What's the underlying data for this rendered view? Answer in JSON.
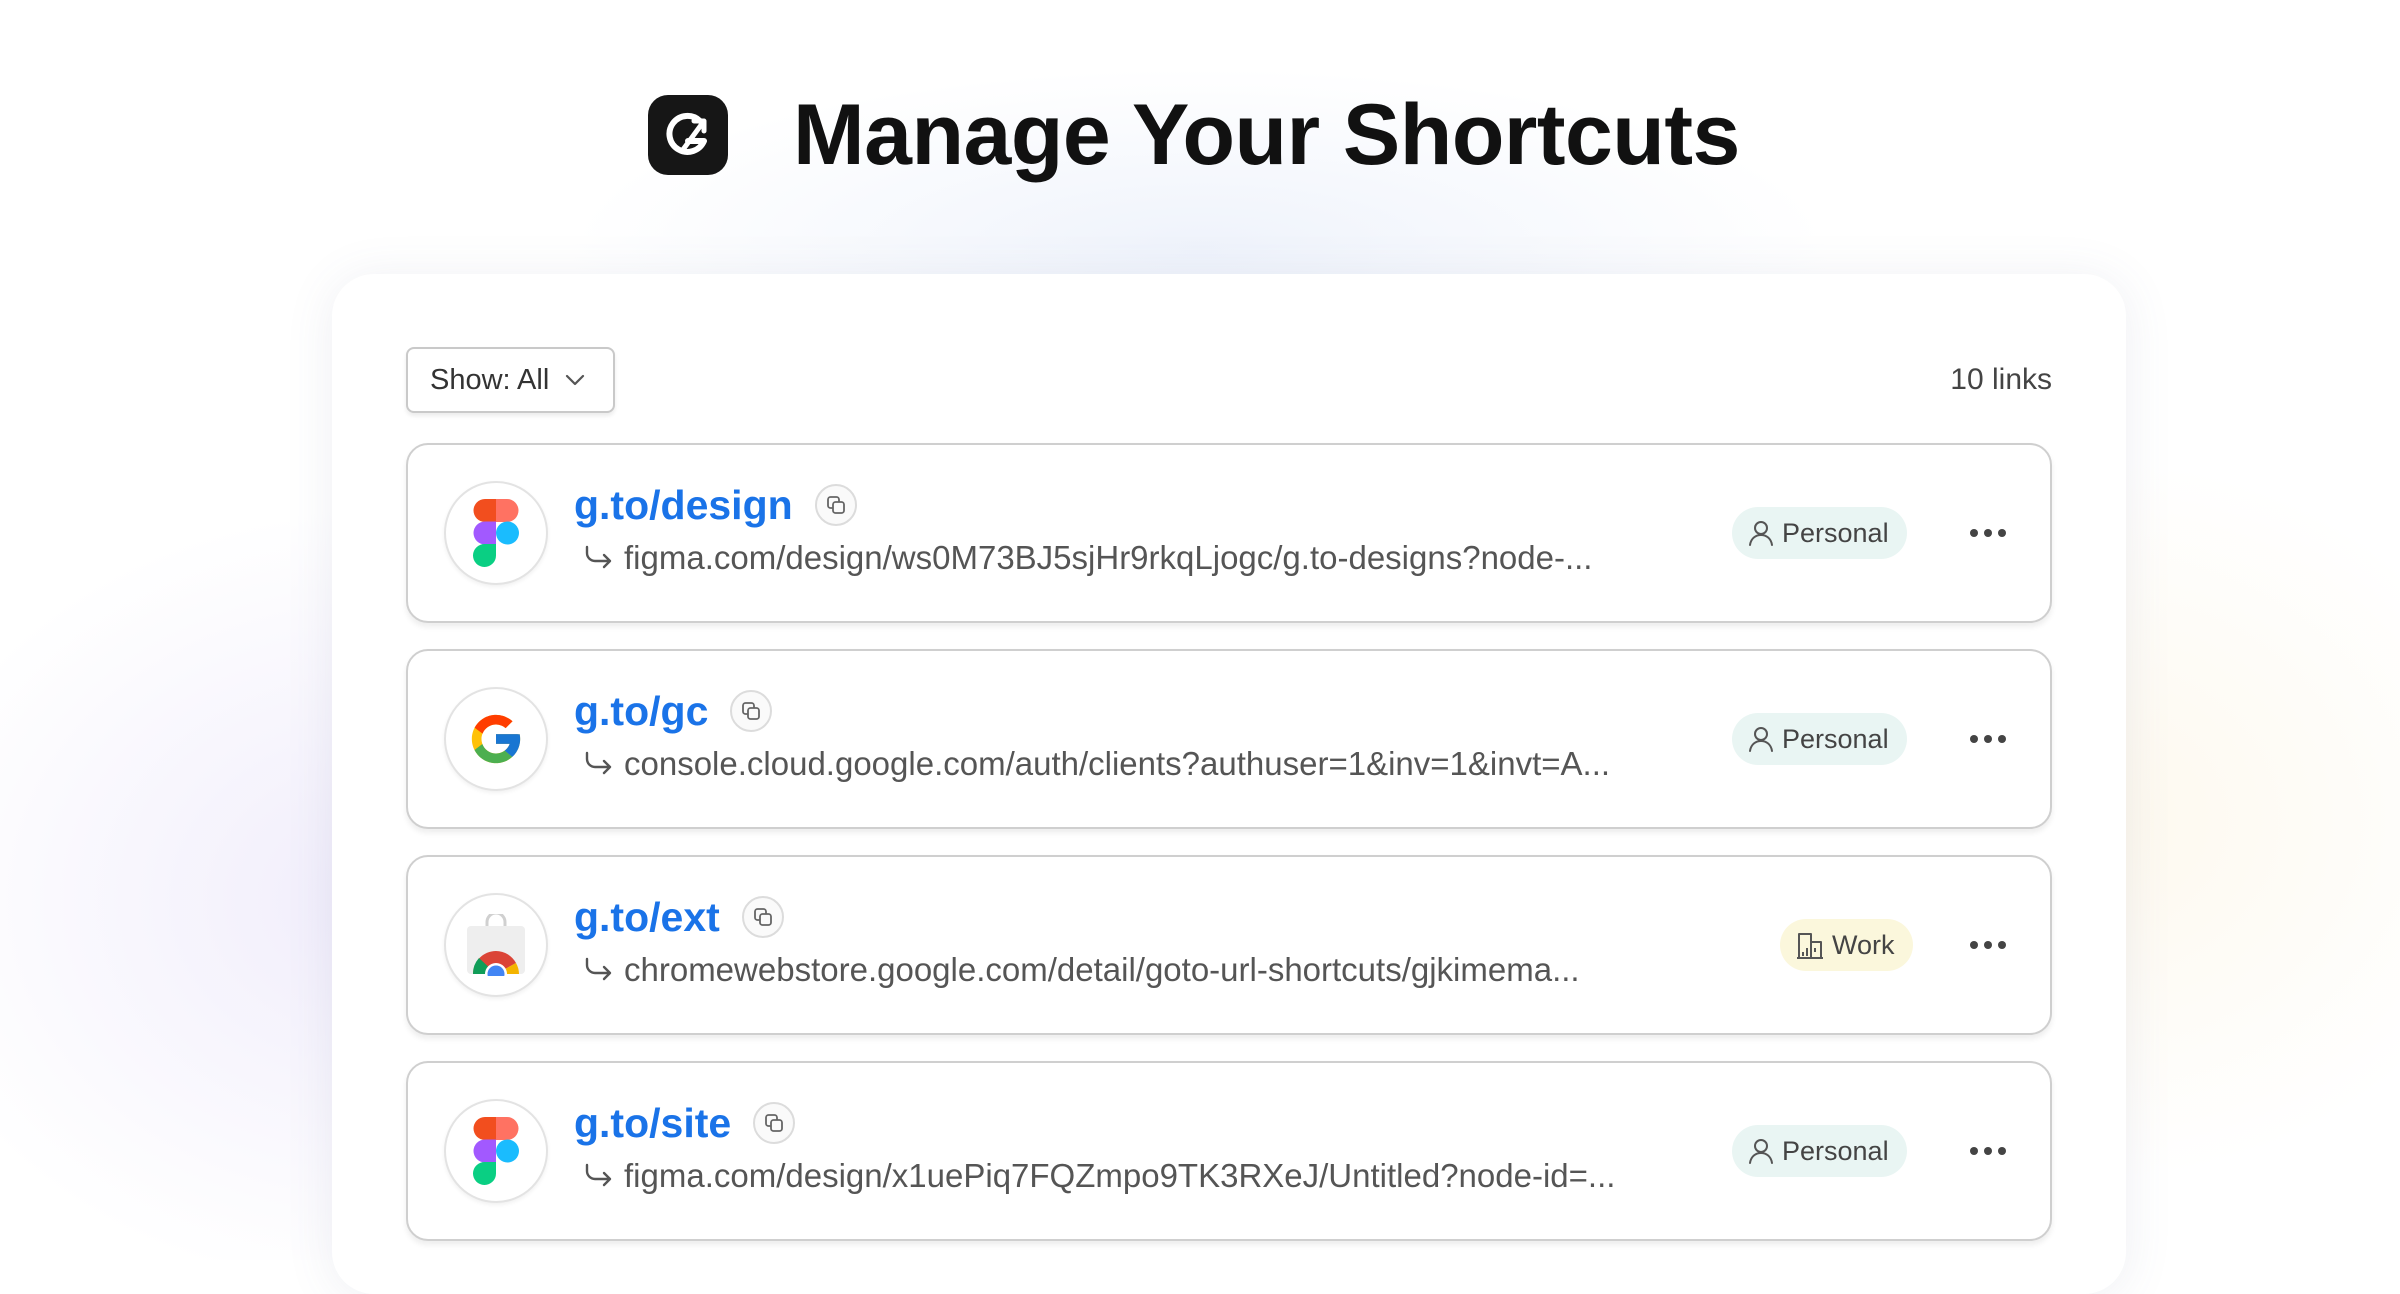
{
  "header": {
    "title": "Manage Your Shortcuts",
    "logo_icon": "g-logo-icon"
  },
  "toolbar": {
    "filter_label": "Show: All",
    "count_label": "10 links"
  },
  "colors": {
    "link": "#1a73e8",
    "personal_tag_bg": "#e9f5f3",
    "work_tag_bg": "#fbf7dc"
  },
  "rows": [
    {
      "shortcut": "g.to/design",
      "destination": "figma.com/design/ws0M73BJ5sjHr9rkqLjogc/g.to-designs?node-...",
      "tag": "Personal",
      "tag_type": "personal",
      "icon": "figma-icon"
    },
    {
      "shortcut": "g.to/gc",
      "destination": "console.cloud.google.com/auth/clients?authuser=1&inv=1&invt=A...",
      "tag": "Personal",
      "tag_type": "personal",
      "icon": "google-icon"
    },
    {
      "shortcut": "g.to/ext",
      "destination": "chromewebstore.google.com/detail/goto-url-shortcuts/gjkimema...",
      "tag": "Work",
      "tag_type": "work",
      "icon": "chrome-web-store-icon"
    },
    {
      "shortcut": "g.to/site",
      "destination": "figma.com/design/x1uePiq7FQZmpo9TK3RXeJ/Untitled?node-id=...",
      "tag": "Personal",
      "tag_type": "personal",
      "icon": "figma-icon"
    }
  ]
}
